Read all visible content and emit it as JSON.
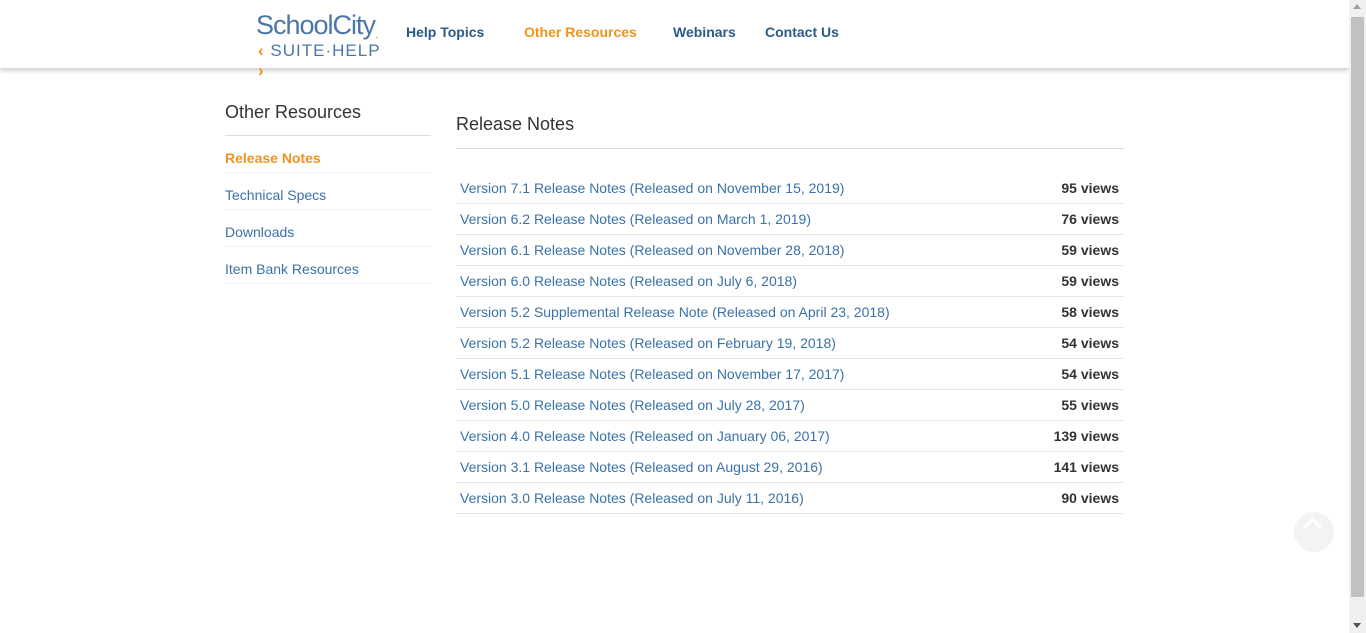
{
  "header": {
    "logo_brand": "SchoolCity",
    "logo_tm": ".",
    "logo_suite": "SUITE·HELP",
    "nav": [
      {
        "label": "Help Topics",
        "active": false
      },
      {
        "label": "Other Resources",
        "active": true
      },
      {
        "label": "Webinars",
        "active": false
      },
      {
        "label": "Contact Us",
        "active": false
      }
    ]
  },
  "sidebar": {
    "title": "Other Resources",
    "items": [
      {
        "label": "Release Notes",
        "active": true
      },
      {
        "label": "Technical Specs",
        "active": false
      },
      {
        "label": "Downloads",
        "active": false
      },
      {
        "label": "Item Bank Resources",
        "active": false
      }
    ]
  },
  "main": {
    "title": "Release Notes",
    "rows": [
      {
        "title": "Version 7.1 Release Notes (Released on November 15, 2019)",
        "views": "95 views"
      },
      {
        "title": "Version 6.2 Release Notes (Released on March 1, 2019)",
        "views": "76 views"
      },
      {
        "title": "Version 6.1 Release Notes (Released on November 28, 2018)",
        "views": "59 views"
      },
      {
        "title": "Version 6.0 Release Notes (Released on July 6, 2018)",
        "views": "59 views"
      },
      {
        "title": "Version 5.2 Supplemental Release Note (Released on April 23, 2018)",
        "views": "58 views"
      },
      {
        "title": "Version 5.2 Release Notes (Released on February 19, 2018)",
        "views": "54 views"
      },
      {
        "title": "Version 5.1 Release Notes (Released on November 17, 2017)",
        "views": "54 views"
      },
      {
        "title": "Version 5.0 Release Notes (Released on July 28, 2017)",
        "views": "55 views"
      },
      {
        "title": "Version 4.0 Release Notes (Released on January 06, 2017)",
        "views": "139 views"
      },
      {
        "title": "Version 3.1 Release Notes (Released on August 29, 2016)",
        "views": "141 views"
      },
      {
        "title": "Version 3.0 Release Notes (Released on July 11, 2016)",
        "views": "90 views"
      }
    ]
  },
  "colors": {
    "accent": "#f0931e",
    "link": "#3a72a8",
    "nav": "#2a5a8a"
  },
  "icons": {
    "back_to_top": "chevron-up-icon"
  }
}
